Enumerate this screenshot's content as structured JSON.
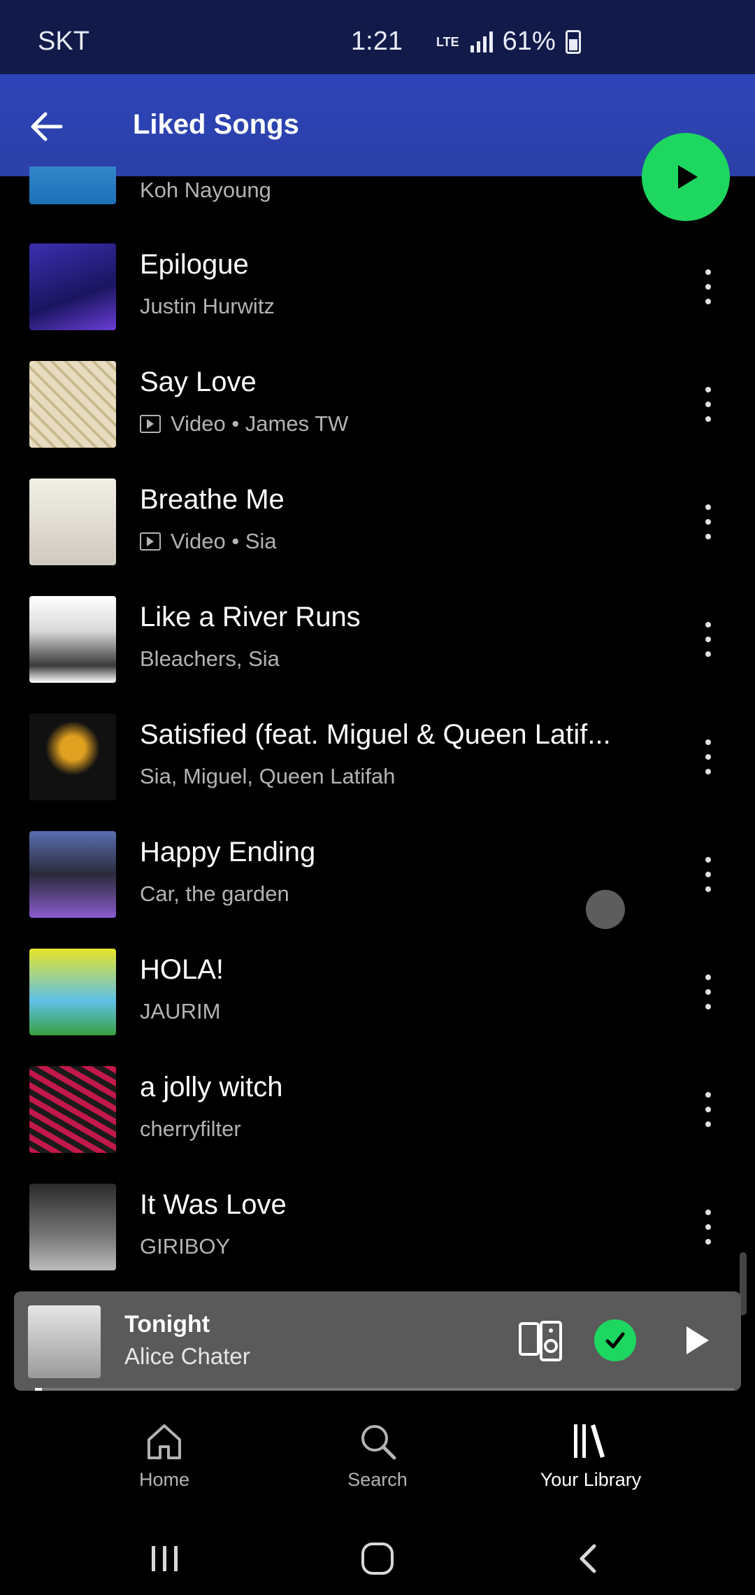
{
  "status_bar": {
    "carrier": "SKT",
    "time": "1:21",
    "network": "LTE",
    "battery_pct": "61%"
  },
  "header": {
    "title": "Liked Songs",
    "back_icon": "arrow-left-icon",
    "play_icon": "play-icon",
    "accent_color": "#2e45b8",
    "play_color": "#1ed760"
  },
  "songs": [
    {
      "title": "",
      "subtitle": "Koh Nayoung",
      "video": false
    },
    {
      "title": "Epilogue",
      "subtitle": "Justin Hurwitz",
      "video": false
    },
    {
      "title": "Say Love",
      "subtitle": "Video • James TW",
      "video": true
    },
    {
      "title": "Breathe Me",
      "subtitle": "Video • Sia",
      "video": true
    },
    {
      "title": "Like a River Runs",
      "subtitle": "Bleachers, Sia",
      "video": false
    },
    {
      "title": "Satisfied (feat. Miguel & Queen Latif...",
      "subtitle": "Sia, Miguel, Queen Latifah",
      "video": false
    },
    {
      "title": "Happy Ending",
      "subtitle": "Car, the garden",
      "video": false
    },
    {
      "title": "HOLA!",
      "subtitle": "JAURIM",
      "video": false
    },
    {
      "title": "a jolly witch",
      "subtitle": "cherryfilter",
      "video": false
    },
    {
      "title": "It Was Love",
      "subtitle": "GIRIBOY",
      "video": false
    }
  ],
  "now_playing": {
    "title": "Tonight",
    "artist": "Alice Chater",
    "device_icon": "connect-device-icon",
    "liked_icon": "liked-check-icon",
    "play_icon": "play-icon",
    "progress": 0.01
  },
  "bottom_nav": [
    {
      "label": "Home",
      "icon": "home-icon",
      "active": false
    },
    {
      "label": "Search",
      "icon": "search-icon",
      "active": false
    },
    {
      "label": "Your Library",
      "icon": "library-icon",
      "active": true
    }
  ],
  "system_nav": [
    "recents-icon",
    "home-button-icon",
    "back-icon"
  ]
}
